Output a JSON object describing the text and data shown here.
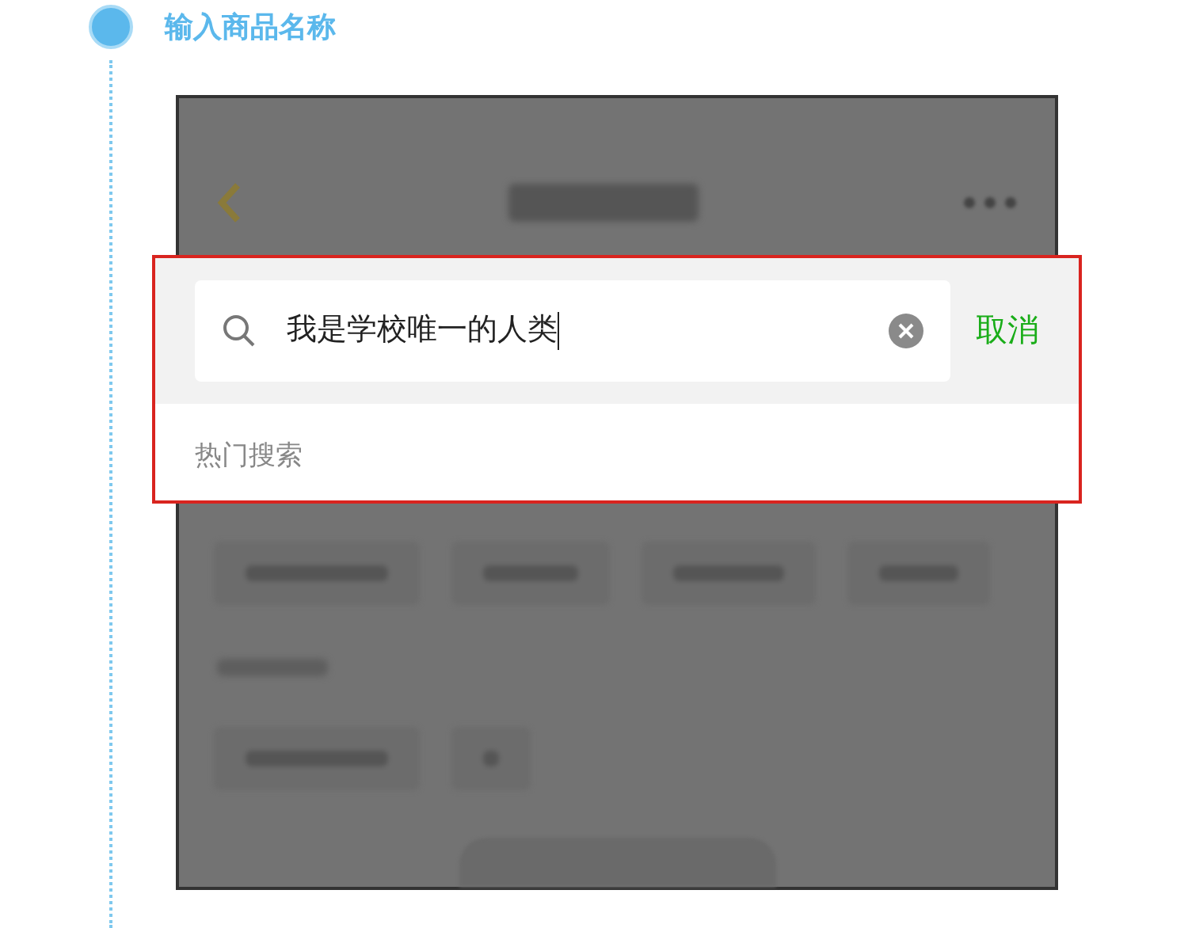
{
  "step": {
    "title": "输入商品名称"
  },
  "search": {
    "value": "我是学校唯一的人类",
    "cancel": "取消",
    "hot_label": "热门搜索"
  }
}
